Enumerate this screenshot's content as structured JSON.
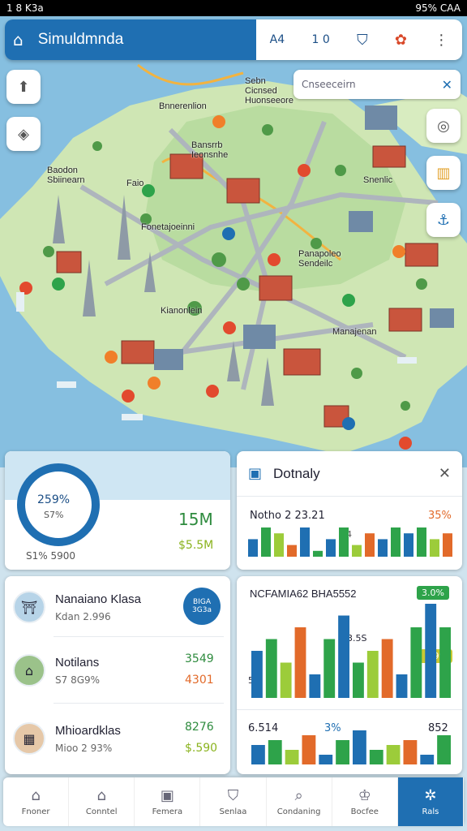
{
  "status": {
    "left": "1 8 K3a",
    "right": "95% CAA"
  },
  "header": {
    "title": "Simuldmnda",
    "rank": "A4",
    "count": "1 0"
  },
  "search": {
    "placeholder": "Cnseeceirn"
  },
  "map": {
    "labels": [
      "Bnnerenlion",
      "Sebn Cicnsed Huonseeore",
      "Bansrrb Ieonsnhe",
      "Baodon Sbiinearn",
      "Faio",
      "Snenlic",
      "Fonetajoeinni",
      "Panapoleo Sendeilc",
      "Kianonlein",
      "Manajenan"
    ]
  },
  "stats_card": {
    "percent": "259%",
    "sub": "S7%",
    "value_big": "15M",
    "value_small": "$5.5M",
    "footer": "S1% 5900",
    "colors": {
      "ring": "#1f6fb2",
      "big": "#2e8b3e",
      "small": "#8ab31e"
    }
  },
  "detail_card": {
    "title": "Dotnaly",
    "chart_label": "Notho 2 23.21",
    "chart_pct": "35%",
    "chart_left": "S4"
  },
  "list": [
    {
      "name": "Nanaiano Klasa",
      "sub": "Kdan 2.996",
      "badge": "BIGA 3G3a"
    },
    {
      "name": "Notilans",
      "sub": "S7 8G9%",
      "v1": "3549",
      "v2": "4301"
    },
    {
      "name": "Mhioardklas",
      "sub": "Mioo 2 93%",
      "v1": "8276",
      "v2": "$.590"
    }
  ],
  "big_chart": {
    "title": "NCFAMIA62 BHA5552",
    "tag1": "3.0%",
    "tag2": "5.9%",
    "lbl1": "3.5S",
    "lbl2": "5%",
    "bot_left": "6.514",
    "bot_mid": "3%",
    "bot_right": "852",
    "ticks": [
      "00",
      "000",
      "00",
      "10",
      "00",
      "00",
      "00"
    ],
    "ticks2": [
      "00",
      "00",
      "00",
      "10",
      "00",
      "900",
      "S000"
    ]
  },
  "nav": [
    {
      "label": "Fnoner",
      "icon": "home-icon",
      "glyph": "⌂"
    },
    {
      "label": "Conntel",
      "icon": "house-icon",
      "glyph": "⌂"
    },
    {
      "label": "Femera",
      "icon": "card-icon",
      "glyph": "▣"
    },
    {
      "label": "Senlaa",
      "icon": "shield-icon",
      "glyph": "⛉"
    },
    {
      "label": "Condaning",
      "icon": "search-icon",
      "glyph": "⌕"
    },
    {
      "label": "Bocfee",
      "icon": "trophy-icon",
      "glyph": "♔"
    },
    {
      "label": "Rals",
      "icon": "gear-icon",
      "glyph": "✲"
    }
  ],
  "chart_data": [
    {
      "type": "bar",
      "title": "Notho 2 23.21",
      "series": [
        {
          "name": "",
          "values": [
            3,
            5,
            4,
            2,
            5,
            1,
            3,
            5,
            2,
            4,
            3,
            5,
            4,
            5,
            3,
            4
          ]
        }
      ]
    },
    {
      "type": "bar",
      "title": "NCFAMIA62 BHA5552",
      "series": [
        {
          "name": "",
          "values": [
            4,
            5,
            3,
            6,
            2,
            5,
            7,
            3,
            4,
            5,
            2,
            6,
            8,
            6
          ]
        }
      ]
    }
  ]
}
